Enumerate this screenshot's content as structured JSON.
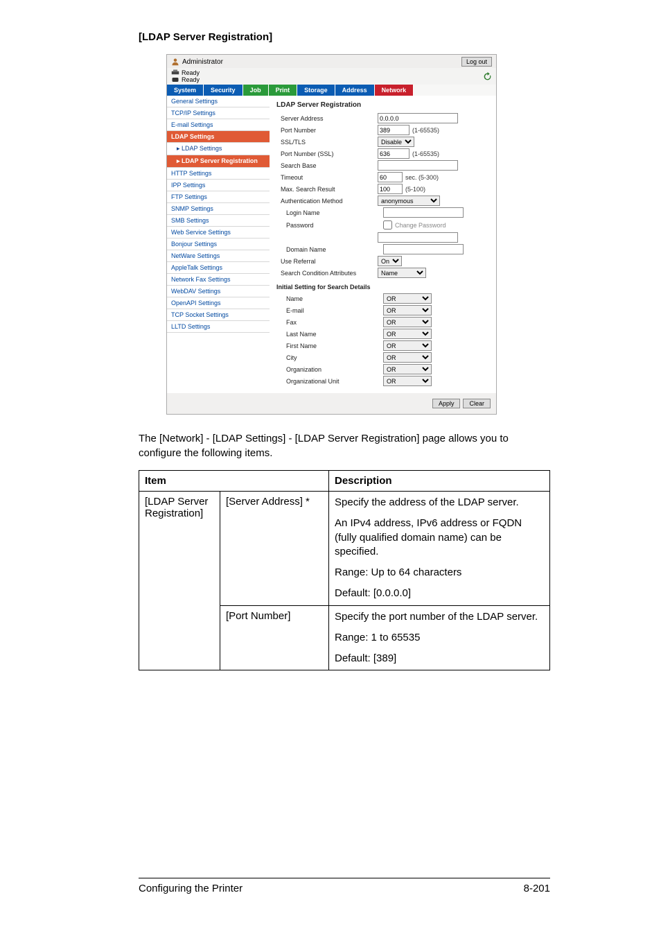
{
  "heading": "[LDAP Server Registration]",
  "app": {
    "user_label": "Administrator",
    "logout": "Log out",
    "status1": "Ready",
    "status2": "Ready",
    "tabs": {
      "system": "System",
      "security": "Security",
      "job": "Job",
      "print": "Print",
      "storage": "Storage",
      "address": "Address",
      "network": "Network"
    },
    "side": {
      "general": "General Settings",
      "tcpip": "TCP/IP Settings",
      "email": "E-mail Settings",
      "ldap": "LDAP Settings",
      "ldap_sub": "LDAP Settings",
      "ldap_reg": "LDAP Server Registration",
      "http": "HTTP Settings",
      "ipp": "IPP Settings",
      "ftp": "FTP Settings",
      "snmp": "SNMP Settings",
      "smb": "SMB Settings",
      "websvc": "Web Service Settings",
      "bonjour": "Bonjour Settings",
      "netware": "NetWare Settings",
      "appletalk": "AppleTalk Settings",
      "netfax": "Network Fax Settings",
      "webdav": "WebDAV Settings",
      "openapi": "OpenAPI Settings",
      "tcpsock": "TCP Socket Settings",
      "lltd": "LLTD Settings"
    },
    "form": {
      "title": "LDAP Server Registration",
      "server_addr_lbl": "Server Address",
      "server_addr_val": "0.0.0.0",
      "port_lbl": "Port Number",
      "port_val": "389",
      "port_range": "(1-65535)",
      "ssl_lbl": "SSL/TLS",
      "ssl_val": "Disable",
      "portssl_lbl": "Port Number (SSL)",
      "portssl_val": "636",
      "portssl_range": "(1-65535)",
      "searchbase_lbl": "Search Base",
      "searchbase_val": "",
      "timeout_lbl": "Timeout",
      "timeout_val": "60",
      "timeout_range": "sec. (5-300)",
      "max_lbl": "Max. Search Result",
      "max_val": "100",
      "max_range": "(5-100)",
      "auth_lbl": "Authentication Method",
      "auth_val": "anonymous",
      "login_lbl": "Login Name",
      "login_val": "",
      "pass_lbl": "Password",
      "pass_chk": "Change Password",
      "pass_val": "",
      "domain_lbl": "Domain Name",
      "domain_val": "",
      "useref_lbl": "Use Referral",
      "useref_val": "On",
      "sca_lbl": "Search Condition Attributes",
      "sca_val": "Name",
      "isd_title": "Initial Setting for Search Details",
      "name_lbl": "Name",
      "name_val": "OR",
      "emailf_lbl": "E-mail",
      "emailf_val": "OR",
      "fax_lbl": "Fax",
      "fax_val": "OR",
      "lname_lbl": "Last Name",
      "lname_val": "OR",
      "fname_lbl": "First Name",
      "fname_val": "OR",
      "city_lbl": "City",
      "city_val": "OR",
      "org_lbl": "Organization",
      "org_val": "OR",
      "orgu_lbl": "Organizational Unit",
      "orgu_val": "OR",
      "apply": "Apply",
      "clear": "Clear"
    }
  },
  "lead": "The [Network] - [LDAP Settings] - [LDAP Server Registration] page allows you to configure the following items.",
  "table": {
    "h_item": "Item",
    "h_desc": "Description",
    "r1_a": "[LDAP Server Registration]",
    "r1_b": "[Server Address] *",
    "r1_c_p1": "Specify the address of the LDAP server.",
    "r1_c_p2": "An IPv4 address, IPv6 address or FQDN (fully qualified domain name) can be specified.",
    "r1_c_p3": "Range: Up to 64 characters",
    "r1_c_p4": "Default: [0.0.0.0]",
    "r2_b": "[Port Number]",
    "r2_c_p1": "Specify the port number of the LDAP server.",
    "r2_c_p2": "Range: 1 to 65535",
    "r2_c_p3": "Default: [389]"
  },
  "footer": {
    "left": "Configuring the Printer",
    "right": "8-201"
  }
}
